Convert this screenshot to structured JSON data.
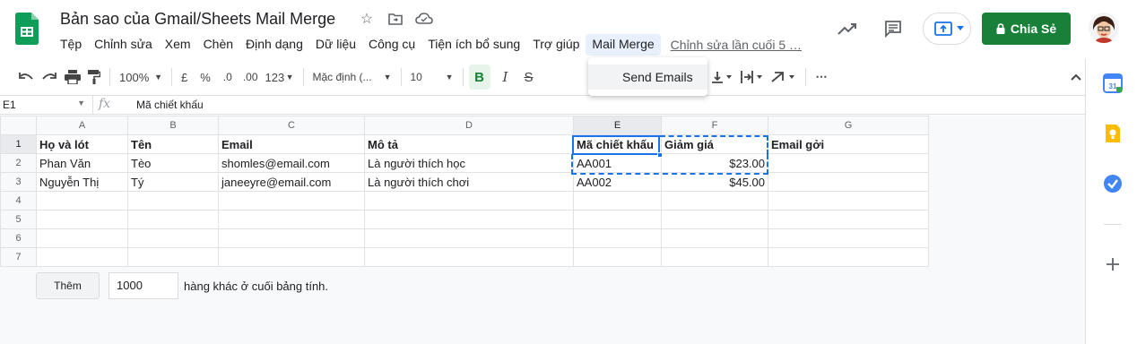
{
  "app": {
    "title": "Bản sao của Gmail/Sheets Mail Merge",
    "menu": [
      "Tệp",
      "Chỉnh sửa",
      "Xem",
      "Chèn",
      "Định dạng",
      "Dữ liệu",
      "Công cụ",
      "Tiện ích bổ sung",
      "Trợ giúp",
      "Mail Merge"
    ],
    "last_edit": "Chỉnh sửa lần cuối 5 …",
    "share_label": "Chia Sẻ",
    "brand_color": "#188038",
    "accent_color": "#1a73e8"
  },
  "dropdown": {
    "item": "Send Emails"
  },
  "toolbar": {
    "zoom": "100%",
    "currency": "£",
    "percent": "%",
    "dec_less": ".0",
    "dec_more": ".00",
    "number_format": "123",
    "font": "Mặc định (...",
    "font_size": "10",
    "bold": "B",
    "italic": "I",
    "strike": "S"
  },
  "formula": {
    "cell_ref": "E1",
    "fx": "fx",
    "value": "Mã chiết khấu"
  },
  "grid": {
    "columns": [
      "A",
      "B",
      "C",
      "D",
      "E",
      "F",
      "G"
    ],
    "rows": [
      {
        "n": "1",
        "cells": [
          "Họ và lót",
          "Tên",
          "Email",
          "Mô tả",
          "Mã chiết khấu",
          "Giảm giá",
          "Email gởi"
        ]
      },
      {
        "n": "2",
        "cells": [
          "Phan Văn",
          "Tèo",
          "shomles@email.com",
          "Là người thích học",
          "AA001",
          "$23.00",
          ""
        ]
      },
      {
        "n": "3",
        "cells": [
          "Nguyễn Thị",
          "Tý",
          "janeeyre@email.com",
          "Là người thích chơi",
          "AA002",
          "$45.00",
          ""
        ]
      },
      {
        "n": "4",
        "cells": [
          "",
          "",
          "",
          "",
          "",
          "",
          ""
        ]
      },
      {
        "n": "5",
        "cells": [
          "",
          "",
          "",
          "",
          "",
          "",
          ""
        ]
      },
      {
        "n": "6",
        "cells": [
          "",
          "",
          "",
          "",
          "",
          "",
          ""
        ]
      },
      {
        "n": "7",
        "cells": [
          "",
          "",
          "",
          "",
          "",
          "",
          ""
        ]
      }
    ]
  },
  "add_rows": {
    "button": "Thêm",
    "count": "1000",
    "suffix": "hàng khác ở cuối bảng tính."
  },
  "icons": [
    "undo-icon",
    "redo-icon",
    "print-icon",
    "paint-format-icon",
    "star-icon",
    "move-icon",
    "cloud-icon",
    "trend-icon",
    "comment-icon",
    "present-icon",
    "lock-icon",
    "calendar-icon",
    "keep-icon",
    "tasks-icon",
    "plus-icon"
  ]
}
